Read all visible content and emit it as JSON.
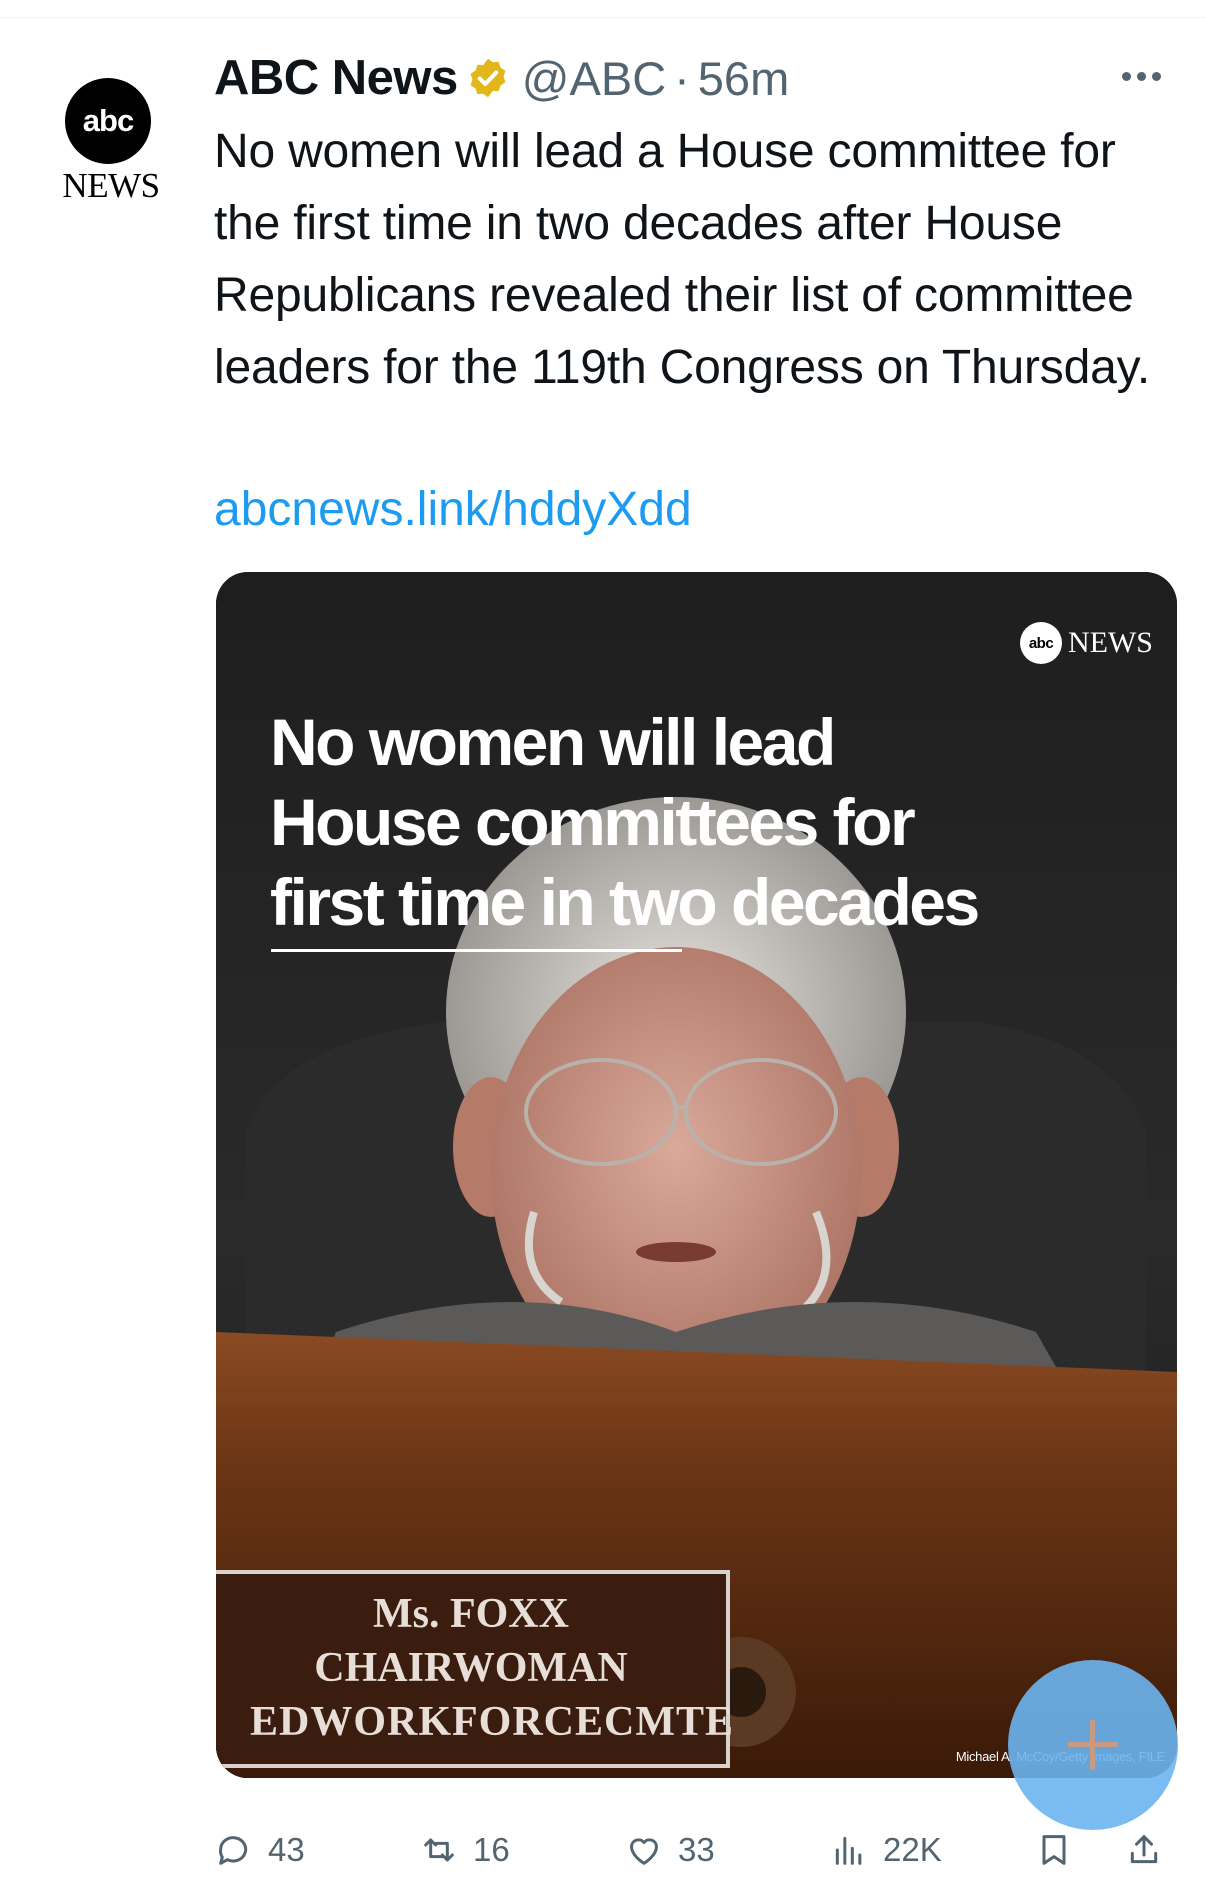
{
  "tweet": {
    "author_name": "ABC News",
    "handle": "@ABC",
    "separator": "·",
    "time": "56m",
    "avatar_text": "abc",
    "avatar_sub": "NEWS",
    "text": "No women will lead a House committee for the first time in two decades after House Republicans revealed their list of committee leaders for the 119th Congress on Thursday.",
    "link": "abcnews.link/hddyXdd"
  },
  "media": {
    "brand_logo": "abc",
    "brand_text": "NEWS",
    "headline_line1": "No women will lead",
    "headline_line2": "House committees for",
    "headline_line3": "first time in two decades",
    "nameplate_line1": "Ms. FOXX",
    "nameplate_line2": "CHAIRWOMAN",
    "nameplate_line3": "EDWORKFORCECMTE",
    "credit": "Michael A. McCoy/Getty Images, FILE"
  },
  "actions": {
    "replies": "43",
    "reposts": "16",
    "likes": "33",
    "views": "22K"
  },
  "colors": {
    "link": "#1d9bf0",
    "secondary": "#536471",
    "verified_gold": "#e2b719",
    "fab": "#6cb4f0"
  },
  "icons": [
    "more-icon",
    "verified-icon",
    "reply-icon",
    "repost-icon",
    "like-icon",
    "views-icon",
    "bookmark-icon",
    "share-icon",
    "compose-icon"
  ]
}
